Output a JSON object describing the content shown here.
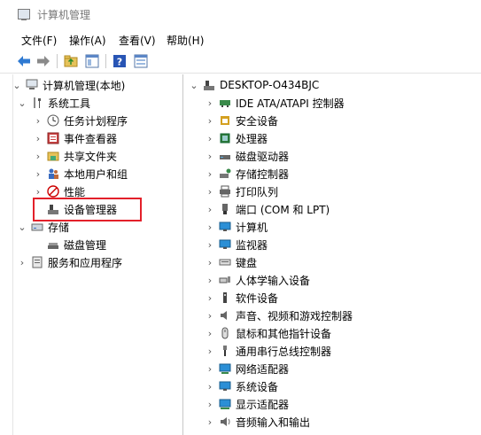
{
  "window": {
    "title": "计算机管理"
  },
  "menu": [
    "文件(F)",
    "操作(A)",
    "查看(V)",
    "帮助(H)"
  ],
  "toolbar": {
    "icons": [
      "back-arrow-icon",
      "forward-arrow-icon",
      "up-folder-icon",
      "show-hide-tree-icon",
      "help-icon",
      "properties-icon"
    ]
  },
  "left_tree": {
    "root": "计算机管理(本地)",
    "system_tools": "系统工具",
    "task_scheduler": "任务计划程序",
    "event_viewer": "事件查看器",
    "shared_folders": "共享文件夹",
    "local_users": "本地用户和组",
    "performance": "性能",
    "device_manager": "设备管理器",
    "storage": "存储",
    "disk_management": "磁盘管理",
    "services_apps": "服务和应用程序"
  },
  "right_tree": {
    "root": "DESKTOP-O434BJC",
    "items": [
      "IDE ATA/ATAPI 控制器",
      "安全设备",
      "处理器",
      "磁盘驱动器",
      "存储控制器",
      "打印队列",
      "端口 (COM 和 LPT)",
      "计算机",
      "监视器",
      "键盘",
      "人体学输入设备",
      "软件设备",
      "声音、视频和游戏控制器",
      "鼠标和其他指针设备",
      "通用串行总线控制器",
      "网络适配器",
      "系统设备",
      "显示适配器",
      "音频输入和输出"
    ]
  },
  "colors": {
    "highlight_border": "#e3202a",
    "title_text": "#777777"
  }
}
